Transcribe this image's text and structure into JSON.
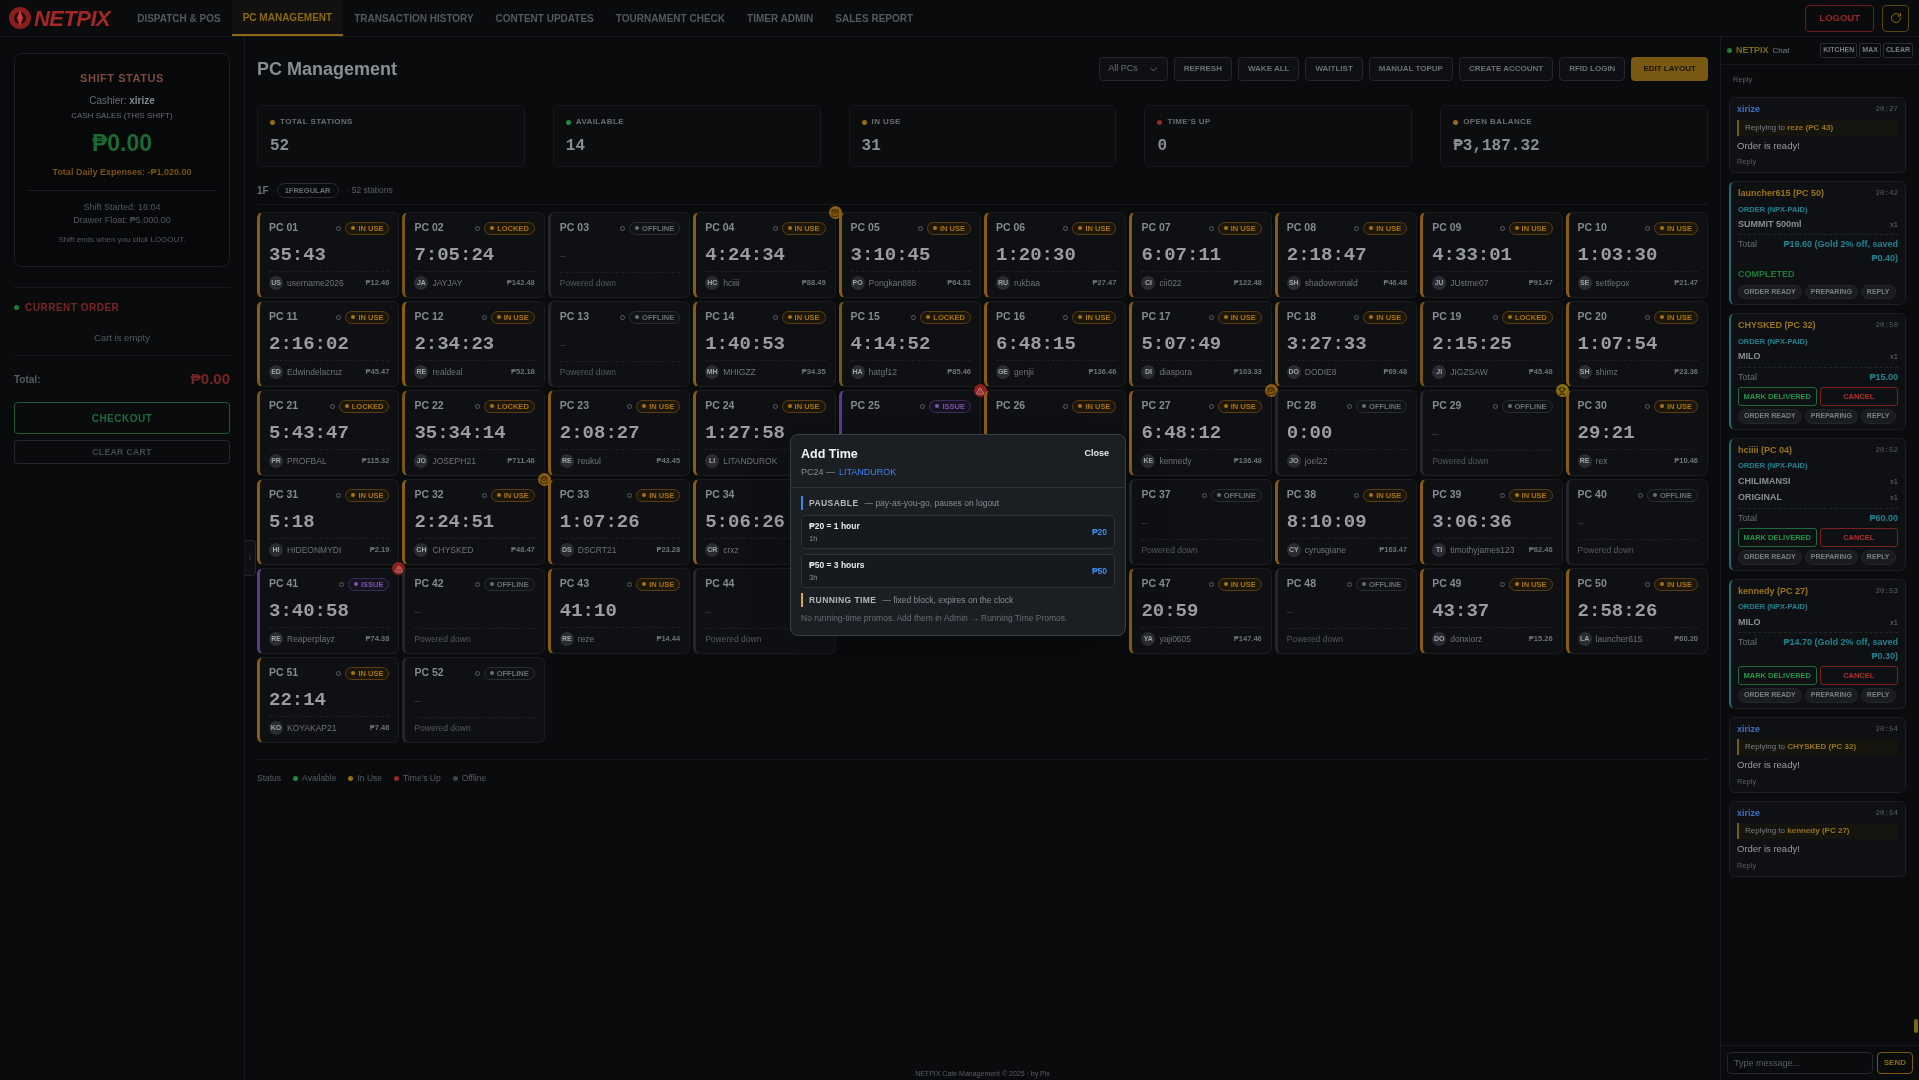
{
  "nav": {
    "logo": "NETPIX",
    "tabs": [
      {
        "label": "DISPATCH & POS",
        "selected": false
      },
      {
        "label": "PC MANAGEMENT",
        "selected": true
      },
      {
        "label": "TRANSACTION HISTORY",
        "selected": false
      },
      {
        "label": "CONTENT UPDATES",
        "selected": false
      },
      {
        "label": "TOURNAMENT CHECK",
        "selected": false
      },
      {
        "label": "TIMER ADMIN",
        "selected": false
      },
      {
        "label": "SALES REPORT",
        "selected": false
      }
    ],
    "logout": "LOGOUT"
  },
  "shift": {
    "title": "SHIFT STATUS",
    "cashier": "Cashier: **xirize**",
    "sales_label": "CASH SALES (THIS SHIFT)",
    "sales": "₱0.00",
    "expenses": "Total Daily Expenses: -₱1,020.00",
    "started": "Shift Started: 16:04",
    "float": "Drawer Float: ₱5,000.00",
    "note": "Shift ends when you click LOGOUT."
  },
  "order": {
    "title": "CURRENT ORDER",
    "empty": "Cart is empty",
    "total_label": "Total:",
    "total": "₱0.00",
    "checkout": "CHECKOUT",
    "clear": "CLEAR CART"
  },
  "page": {
    "title": "PC Management",
    "filter": "All PCs",
    "actions": [
      {
        "label": "REFRESH",
        "kind": "plain"
      },
      {
        "label": "WAKE ALL",
        "kind": "plain"
      },
      {
        "label": "WAITLIST",
        "kind": "plain"
      },
      {
        "label": "MANUAL TOPUP",
        "kind": "plain"
      },
      {
        "label": "CREATE ACCOUNT",
        "kind": "plain"
      },
      {
        "label": "RFID LOGIN",
        "kind": "plain"
      },
      {
        "label": "EDIT LAYOUT",
        "kind": "primary"
      }
    ]
  },
  "stats": [
    {
      "label": "TOTAL STATIONS",
      "value": "52",
      "color": "#9a6a14"
    },
    {
      "label": "AVAILABLE",
      "value": "14",
      "color": "#1f8a3f"
    },
    {
      "label": "IN USE",
      "value": "31",
      "color": "#9a6a14"
    },
    {
      "label": "TIME'S UP",
      "value": "0",
      "color": "#9b2626"
    },
    {
      "label": "OPEN BALANCE",
      "value": "₱3,187.32",
      "color": "#9a6a14"
    }
  ],
  "floor": {
    "name": "1F",
    "tag": "1FREGULAR",
    "count": "· 52 stations"
  },
  "stations": [
    {
      "kind": "in_use",
      "name": "PC 01",
      "badge": "IN USE",
      "timer": "35:43",
      "initials": "US",
      "user": "username2026",
      "price": "₱12.46"
    },
    {
      "kind": "locked",
      "name": "PC 02",
      "badge": "LOCKED",
      "timer": "7:05:24",
      "initials": "JA",
      "user": "JAYJAY",
      "price": "₱142.48"
    },
    {
      "kind": "offline",
      "name": "PC 03",
      "badge": "OFFLINE",
      "dash": "–",
      "note": "Powered down"
    },
    {
      "kind": "in_use",
      "name": "PC 04",
      "badge": "IN USE",
      "timer": "4:24:34",
      "initials": "HC",
      "user": "hciiii",
      "price": "₱88.49",
      "corner": {
        "kind": "order"
      }
    },
    {
      "kind": "in_use",
      "name": "PC 05",
      "badge": "IN USE",
      "timer": "3:10:45",
      "initials": "PO",
      "user": "Pongkan888",
      "price": "₱64.31"
    },
    {
      "kind": "in_use",
      "name": "PC 06",
      "badge": "IN USE",
      "timer": "1:20:30",
      "initials": "RU",
      "user": "rukbaa",
      "price": "₱27.47"
    },
    {
      "kind": "in_use",
      "name": "PC 07",
      "badge": "IN USE",
      "timer": "6:07:11",
      "initials": "CI",
      "user": "cii022",
      "price": "₱122.48"
    },
    {
      "kind": "in_use",
      "name": "PC 08",
      "badge": "IN USE",
      "timer": "2:18:47",
      "initials": "SH",
      "user": "shadowronald",
      "price": "₱46.48"
    },
    {
      "kind": "in_use",
      "name": "PC 09",
      "badge": "IN USE",
      "timer": "4:33:01",
      "initials": "JU",
      "user": "JUstme07",
      "price": "₱91.47"
    },
    {
      "kind": "in_use",
      "name": "PC 10",
      "badge": "IN USE",
      "timer": "1:03:30",
      "initials": "SE",
      "user": "settlepox",
      "price": "₱21.47"
    },
    {
      "kind": "in_use",
      "name": "PC 11",
      "badge": "IN USE",
      "timer": "2:16:02",
      "initials": "ED",
      "user": "Edwindelacruz",
      "price": "₱45.47"
    },
    {
      "kind": "in_use",
      "name": "PC 12",
      "badge": "IN USE",
      "timer": "2:34:23",
      "initials": "RE",
      "user": "realdeal",
      "price": "₱52.18"
    },
    {
      "kind": "offline",
      "name": "PC 13",
      "badge": "OFFLINE",
      "dash": "–",
      "note": "Powered down"
    },
    {
      "kind": "in_use",
      "name": "PC 14",
      "badge": "IN USE",
      "timer": "1:40:53",
      "initials": "MH",
      "user": "MHIGZZ",
      "price": "₱34.35"
    },
    {
      "kind": "locked",
      "name": "PC 15",
      "badge": "LOCKED",
      "timer": "4:14:52",
      "initials": "HA",
      "user": "hatgf12",
      "price": "₱85.46"
    },
    {
      "kind": "in_use",
      "name": "PC 16",
      "badge": "IN USE",
      "timer": "6:48:15",
      "initials": "GE",
      "user": "genjii",
      "price": "₱136.46"
    },
    {
      "kind": "in_use",
      "name": "PC 17",
      "badge": "IN USE",
      "timer": "5:07:49",
      "initials": "DI",
      "user": "diaspora",
      "price": "₱103.33"
    },
    {
      "kind": "in_use",
      "name": "PC 18",
      "badge": "IN USE",
      "timer": "3:27:33",
      "initials": "DO",
      "user": "DODIE8",
      "price": "₱69.48"
    },
    {
      "kind": "locked",
      "name": "PC 19",
      "badge": "LOCKED",
      "timer": "2:15:25",
      "initials": "JI",
      "user": "JIGZSAW",
      "price": "₱45.48"
    },
    {
      "kind": "in_use",
      "name": "PC 20",
      "badge": "IN USE",
      "timer": "1:07:54",
      "initials": "SH",
      "user": "shimz",
      "price": "₱23.36"
    },
    {
      "kind": "locked",
      "name": "PC 21",
      "badge": "LOCKED",
      "timer": "5:43:47",
      "initials": "PR",
      "user": "PROFBAL",
      "price": "₱115.32"
    },
    {
      "kind": "locked",
      "name": "PC 22",
      "badge": "LOCKED",
      "timer": "35:34:14",
      "initials": "JO",
      "user": "JOSEPH21",
      "price": "₱711.46"
    },
    {
      "kind": "in_use",
      "name": "PC 23",
      "badge": "IN USE",
      "timer": "2:08:27",
      "initials": "RE",
      "user": "reukul",
      "price": "₱43.45"
    },
    {
      "kind": "in_use",
      "name": "PC 24",
      "badge": "IN USE",
      "timer": "1:27:58",
      "initials": "LI",
      "user": "LITANDUROK"
    },
    {
      "kind": "issue",
      "name": "PC 25",
      "badge": "ISSUE",
      "corner": {
        "kind": "warning"
      }
    },
    {
      "kind": "in_use",
      "name": "PC 26",
      "badge": "IN USE"
    },
    {
      "kind": "in_use",
      "name": "PC 27",
      "badge": "IN USE",
      "timer": "6:48:12",
      "initials": "KE",
      "user": "kennedy",
      "price": "₱136.48",
      "corner": {
        "kind": "order"
      }
    },
    {
      "kind": "offline",
      "name": "PC 28",
      "badge": "OFFLINE",
      "timer": "0:00",
      "initials": "JO",
      "user": "joel22"
    },
    {
      "kind": "offline",
      "name": "PC 29",
      "badge": "OFFLINE",
      "dash": "–",
      "note": "Powered down",
      "corner": {
        "kind": "trophy"
      }
    },
    {
      "kind": "in_use",
      "name": "PC 30",
      "badge": "IN USE",
      "timer": "29:21",
      "initials": "RE",
      "user": "rex",
      "price": "₱10.46"
    },
    {
      "kind": "in_use",
      "name": "PC 31",
      "badge": "IN USE",
      "timer": "5:18",
      "initials": "HI",
      "user": "HIDEONMYDI",
      "price": "₱2.19"
    },
    {
      "kind": "in_use",
      "name": "PC 32",
      "badge": "IN USE",
      "timer": "2:24:51",
      "initials": "CH",
      "user": "CHYSKED",
      "price": "₱48.47",
      "corner": {
        "kind": "order"
      }
    },
    {
      "kind": "in_use",
      "name": "PC 33",
      "badge": "IN USE",
      "timer": "1:07:26",
      "initials": "DS",
      "user": "DSCRT21",
      "price": "₱23.28"
    },
    {
      "kind": "in_use",
      "name": "PC 34",
      "timer": "5:06:26",
      "initials": "CR",
      "user": "crxz"
    },
    {
      "kind": "covered"
    },
    {
      "kind": "covered"
    },
    {
      "kind": "offline",
      "name": "PC 37",
      "badge": "OFFLINE",
      "dash": "–",
      "note": "Powered down"
    },
    {
      "kind": "in_use",
      "name": "PC 38",
      "badge": "IN USE",
      "timer": "8:10:09",
      "initials": "CY",
      "user": "cyrusgiane",
      "price": "₱163.47"
    },
    {
      "kind": "in_use",
      "name": "PC 39",
      "badge": "IN USE",
      "timer": "3:06:36",
      "initials": "TI",
      "user": "timothyjames123",
      "price": "₱62.46"
    },
    {
      "kind": "offline",
      "name": "PC 40",
      "badge": "OFFLINE",
      "dash": "–",
      "note": "Powered down"
    },
    {
      "kind": "issue",
      "name": "PC 41",
      "badge": "ISSUE",
      "timer": "3:40:58",
      "initials": "RE",
      "user": "Reaperplayz",
      "price": "₱74.38",
      "corner": {
        "kind": "warning"
      }
    },
    {
      "kind": "offline",
      "name": "PC 42",
      "badge": "OFFLINE",
      "dash": "–",
      "note": "Powered down"
    },
    {
      "kind": "in_use",
      "name": "PC 43",
      "badge": "IN USE",
      "timer": "41:10",
      "initials": "RE",
      "user": "reze",
      "price": "₱14.44"
    },
    {
      "kind": "offline",
      "name": "PC 44",
      "dash": "–",
      "note": "Powered down"
    },
    {
      "kind": "covered"
    },
    {
      "kind": "covered"
    },
    {
      "kind": "in_use",
      "name": "PC 47",
      "badge": "IN USE",
      "timer": "20:59",
      "initials": "YA",
      "user": "yaji0605",
      "price": "₱147.46"
    },
    {
      "kind": "offline",
      "name": "PC 48",
      "badge": "OFFLINE",
      "dash": "–",
      "note": "Powered down"
    },
    {
      "kind": "in_use",
      "name": "PC 49",
      "badge": "IN USE",
      "timer": "43:37",
      "initials": "DO",
      "user": "donxiorz",
      "price": "₱15.26"
    },
    {
      "kind": "in_use",
      "name": "PC 50",
      "badge": "IN USE",
      "timer": "2:58:26",
      "initials": "LA",
      "user": "launcher615",
      "price": "₱60.20"
    },
    {
      "kind": "in_use",
      "name": "PC 51",
      "badge": "IN USE",
      "timer": "22:14",
      "initials": "KO",
      "user": "KOYAKAP21",
      "price": "₱7.46"
    },
    {
      "kind": "offline",
      "name": "PC 52",
      "badge": "OFFLINE",
      "dash": "–",
      "note": "Powered down"
    }
  ],
  "legend": {
    "title": "Status",
    "items": [
      {
        "label": "Available",
        "color": "#1f8a3f"
      },
      {
        "label": "In Use",
        "color": "#9a6a14"
      },
      {
        "label": "Time's Up",
        "color": "#9b2626"
      },
      {
        "label": "Offline",
        "color": "#3f434a"
      }
    ]
  },
  "modal": {
    "title": "Add Time",
    "station": "PC24 —",
    "user": "LITANDUROK",
    "close": "Close",
    "sections": [
      {
        "name": "PAUSABLE",
        "desc": "— pay-as-you-go, pauses on logout",
        "color": "#3b82f6",
        "options": [
          {
            "label": "₱20 = 1 hour",
            "sub": "1h",
            "price": "₱20"
          },
          {
            "label": "₱50 = 3 hours",
            "sub": "3h",
            "price": "₱50"
          }
        ]
      },
      {
        "name": "RUNNING TIME",
        "desc": "— fixed block, expires on the clock",
        "color": "#e0a93a",
        "empty": "No running-time promos. Add them in Admin → Running Time Promos."
      }
    ]
  },
  "footer": "NETPIX Cafe Management © 2025 · by Pix",
  "chat": {
    "brand": "NETPIX",
    "title": "Chat",
    "tools": [
      "KITCHEN",
      "MAX",
      "CLEAR"
    ],
    "messages": [
      {
        "kind": "tail",
        "action": "Reply"
      },
      {
        "kind": "reply",
        "author": "xirize",
        "time": "20:27",
        "reply_to": "Replying to **reze (PC 43)**",
        "text": "Order is ready!",
        "action": "Reply"
      },
      {
        "kind": "order",
        "author": "launcher615 (PC 50)",
        "time": "20:42",
        "tag": "ORDER (NPX-PAID)",
        "items": [
          {
            "name": "SUMMIT 500ml",
            "qty": "x1"
          }
        ],
        "total_label": "Total",
        "total": "₱19.60 (Gold 2% off, saved ₱0.40)",
        "status": "COMPLETED",
        "pills": [
          "ORDER READY",
          "PREPARING",
          "REPLY"
        ]
      },
      {
        "kind": "order",
        "author": "CHYSKED (PC 32)",
        "time": "20:50",
        "tag": "ORDER (NPX-PAID)",
        "items": [
          {
            "name": "MILO",
            "qty": "x1"
          }
        ],
        "total_label": "Total",
        "total": "₱15.00",
        "deliver": "MARK DELIVERED",
        "cancel": "CANCEL",
        "pills": [
          "ORDER READY",
          "PREPARING",
          "REPLY"
        ]
      },
      {
        "kind": "order",
        "author": "hciiii (PC 04)",
        "time": "20:52",
        "tag": "ORDER (NPX-PAID)",
        "items": [
          {
            "name": "CHILIMANSI",
            "qty": "x1"
          },
          {
            "name": "ORIGINAL",
            "qty": "x1"
          }
        ],
        "total_label": "Total",
        "total": "₱60.00",
        "deliver": "MARK DELIVERED",
        "cancel": "CANCEL",
        "pills": [
          "ORDER READY",
          "PREPARING",
          "REPLY"
        ]
      },
      {
        "kind": "order",
        "author": "kennedy (PC 27)",
        "time": "20:53",
        "tag": "ORDER (NPX-PAID)",
        "items": [
          {
            "name": "MILO",
            "qty": "x1"
          }
        ],
        "total_label": "Total",
        "total": "₱14.70 (Gold 2% off, saved ₱0.30)",
        "deliver": "MARK DELIVERED",
        "cancel": "CANCEL",
        "pills": [
          "ORDER READY",
          "PREPARING",
          "REPLY"
        ]
      },
      {
        "kind": "reply",
        "author": "xirize",
        "time": "20:54",
        "reply_to": "Replying to **CHYSKED (PC 32)**",
        "text": "Order is ready!",
        "action": "Reply"
      },
      {
        "kind": "reply",
        "author": "xirize",
        "time": "20:54",
        "reply_to": "Replying to **kennedy (PC 27)**",
        "text": "Order is ready!",
        "action": "Reply"
      }
    ],
    "placeholder": "Type message...",
    "send": "SEND"
  }
}
